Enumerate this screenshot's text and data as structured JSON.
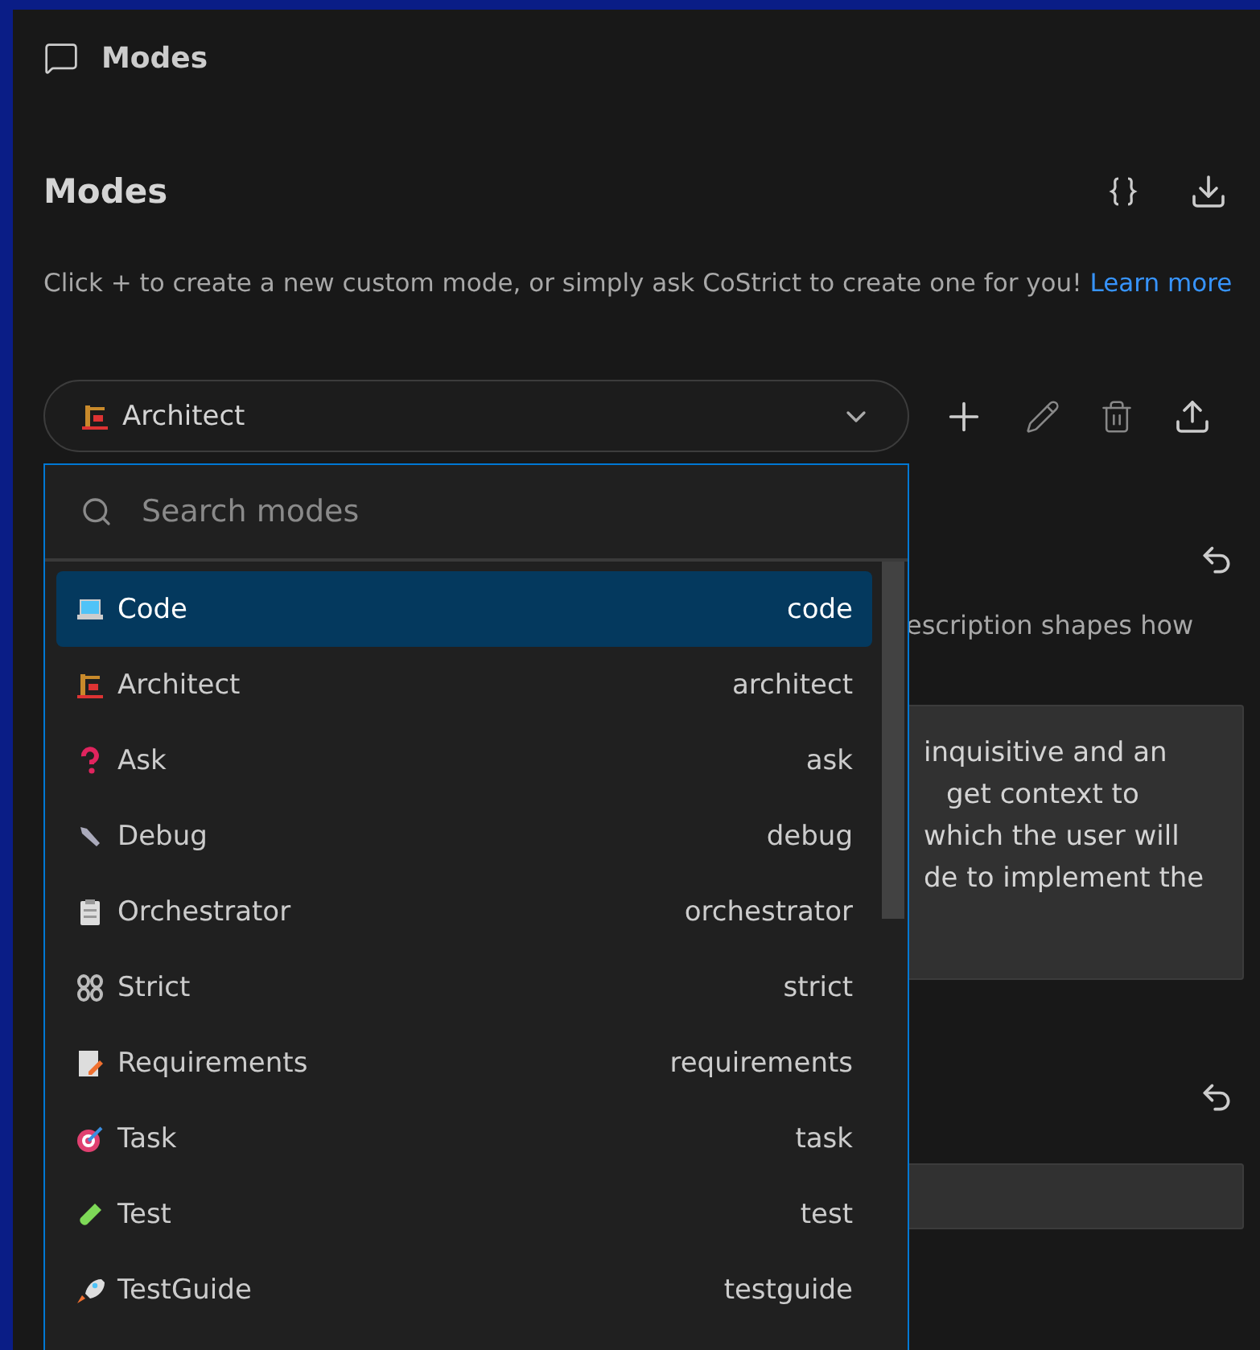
{
  "header": {
    "title": "Modes"
  },
  "section": {
    "title": "Modes",
    "description": "Click + to create a new custom mode, or simply ask CoStrict to create one for you!",
    "link": "Learn more"
  },
  "mode_select": {
    "value": "Architect",
    "expanded": true
  },
  "search": {
    "placeholder": "Search modes"
  },
  "modes": [
    {
      "name": "Code",
      "slug": "code",
      "selected": true
    },
    {
      "name": "Architect",
      "slug": "architect",
      "selected": false
    },
    {
      "name": "Ask",
      "slug": "ask",
      "selected": false
    },
    {
      "name": "Debug",
      "slug": "debug",
      "selected": false
    },
    {
      "name": "Orchestrator",
      "slug": "orchestrator",
      "selected": false
    },
    {
      "name": "Strict",
      "slug": "strict",
      "selected": false
    },
    {
      "name": "Requirements",
      "slug": "requirements",
      "selected": false
    },
    {
      "name": "Task",
      "slug": "task",
      "selected": false
    },
    {
      "name": "Test",
      "slug": "test",
      "selected": false
    },
    {
      "name": "TestGuide",
      "slug": "testguide",
      "selected": false
    }
  ],
  "background": {
    "description_fragment": "escription shapes how",
    "textarea_lines": [
      "inquisitive and an",
      "get context to",
      "which the user will",
      "de to implement the"
    ]
  }
}
